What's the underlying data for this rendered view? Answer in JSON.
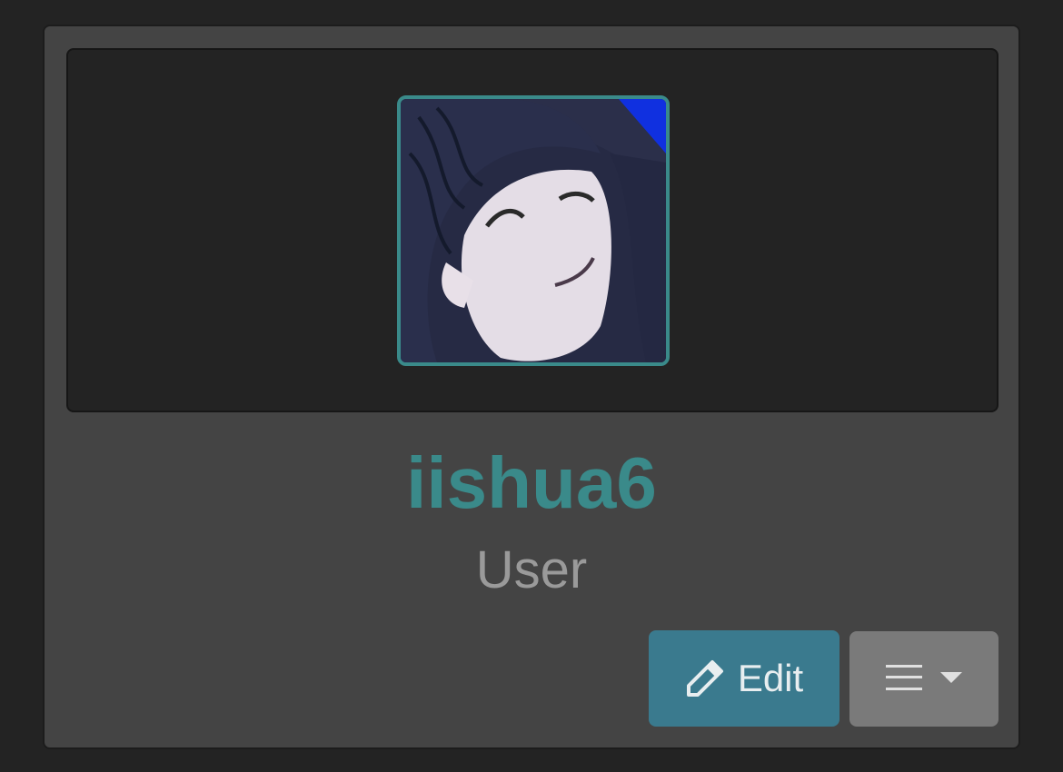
{
  "profile": {
    "username": "iishua6",
    "role": "User",
    "avatar_icon": "user-avatar-image"
  },
  "actions": {
    "edit_label": "Edit",
    "edit_icon": "pencil-icon",
    "menu_icon": "hamburger-menu-icon",
    "menu_caret_icon": "caret-down-icon"
  },
  "colors": {
    "accent": "#3a8a8a",
    "edit_button": "#3a7a8e",
    "menu_button": "#7a7a7a",
    "card_bg": "#444444",
    "banner_bg": "#232323"
  }
}
